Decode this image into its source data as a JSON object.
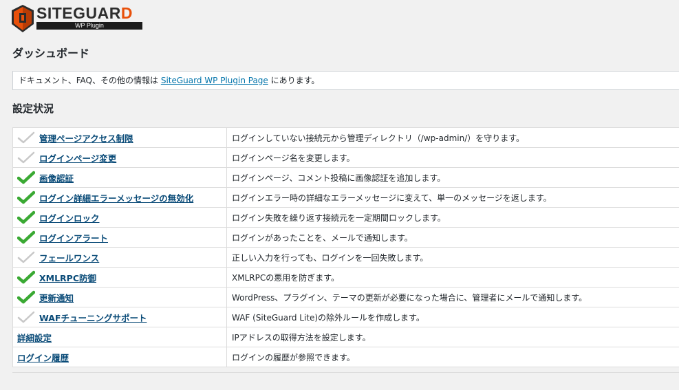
{
  "logo": {
    "title_main": "SITEGUAR",
    "title_accent": "D",
    "subtitle": "WP Plugin"
  },
  "page_title": "ダッシュボード",
  "notice": {
    "before": "ドキュメント、FAQ、その他の情報は ",
    "link": "SiteGuard WP Plugin Page",
    "after": " にあります。"
  },
  "section_title": "設定状況",
  "colors": {
    "link": "#0a4b78",
    "check_on": "#3aa933",
    "check_off": "#c8c8c8"
  },
  "rows": [
    {
      "name": "管理ページアクセス制限",
      "desc": "ログインしていない接続元から管理ディレクトリ（/wp-admin/）を守ります。",
      "status": "off"
    },
    {
      "name": "ログインページ変更",
      "desc": "ログインページ名を変更します。",
      "status": "off"
    },
    {
      "name": "画像認証",
      "desc": "ログインページ、コメント投稿に画像認証を追加します。",
      "status": "on"
    },
    {
      "name": "ログイン詳細エラーメッセージの無効化",
      "desc": "ログインエラー時の詳細なエラーメッセージに変えて、単一のメッセージを返します。",
      "status": "on"
    },
    {
      "name": "ログインロック",
      "desc": "ログイン失敗を繰り返す接続元を一定期間ロックします。",
      "status": "on"
    },
    {
      "name": "ログインアラート",
      "desc": "ログインがあったことを、メールで通知します。",
      "status": "on"
    },
    {
      "name": "フェールワンス",
      "desc": "正しい入力を行っても、ログインを一回失敗します。",
      "status": "off"
    },
    {
      "name": "XMLRPC防御",
      "desc": "XMLRPCの悪用を防ぎます。",
      "status": "on"
    },
    {
      "name": "更新通知",
      "desc": "WordPress、プラグイン、テーマの更新が必要になった場合に、管理者にメールで通知します。",
      "status": "on"
    },
    {
      "name": "WAFチューニングサポート",
      "desc": "WAF (SiteGuard Lite)の除外ルールを作成します。",
      "status": "off"
    },
    {
      "name": "詳細設定",
      "desc": "IPアドレスの取得方法を設定します。",
      "status": "none"
    },
    {
      "name": "ログイン履歴",
      "desc": "ログインの履歴が参照できます。",
      "status": "none"
    }
  ]
}
